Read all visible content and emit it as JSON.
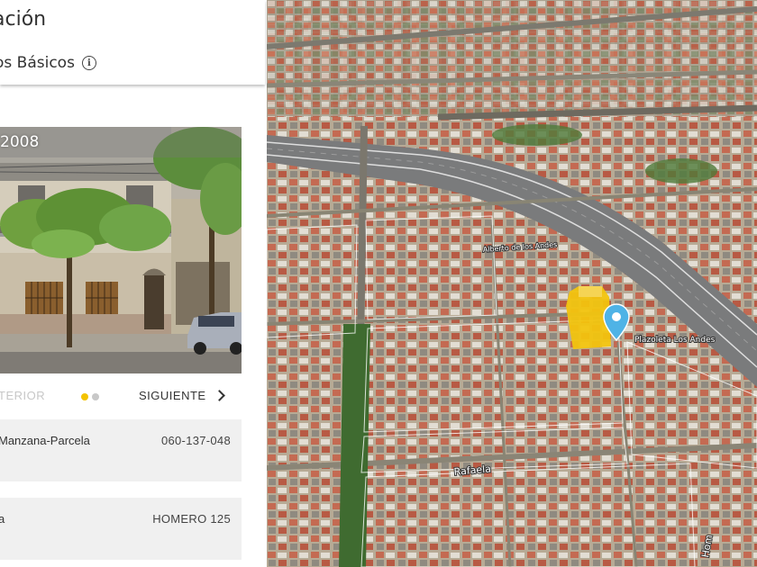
{
  "header": {
    "title": "ación",
    "subtitle": "os Básicos",
    "info_glyph": "i"
  },
  "photo": {
    "date": "2008"
  },
  "carousel": {
    "prev_label": "TERIOR",
    "next_label": "SIGUIENTE",
    "dots": [
      {
        "active": true,
        "color": "#f3c300"
      },
      {
        "active": false,
        "color": "#c8c8c8"
      }
    ]
  },
  "details": [
    {
      "label": "Manzana-Parcela",
      "value": "060-137-048"
    },
    {
      "label": "a",
      "value": "HOMERO 125"
    }
  ],
  "map": {
    "labels": {
      "plaza": "Plazoleta Los Andes",
      "street1": "Rafaela",
      "street2": "Hom",
      "park": "Alberto de los Andes"
    },
    "highlight_color": "#f2c40f",
    "pin_color": "#4fb3e6"
  }
}
